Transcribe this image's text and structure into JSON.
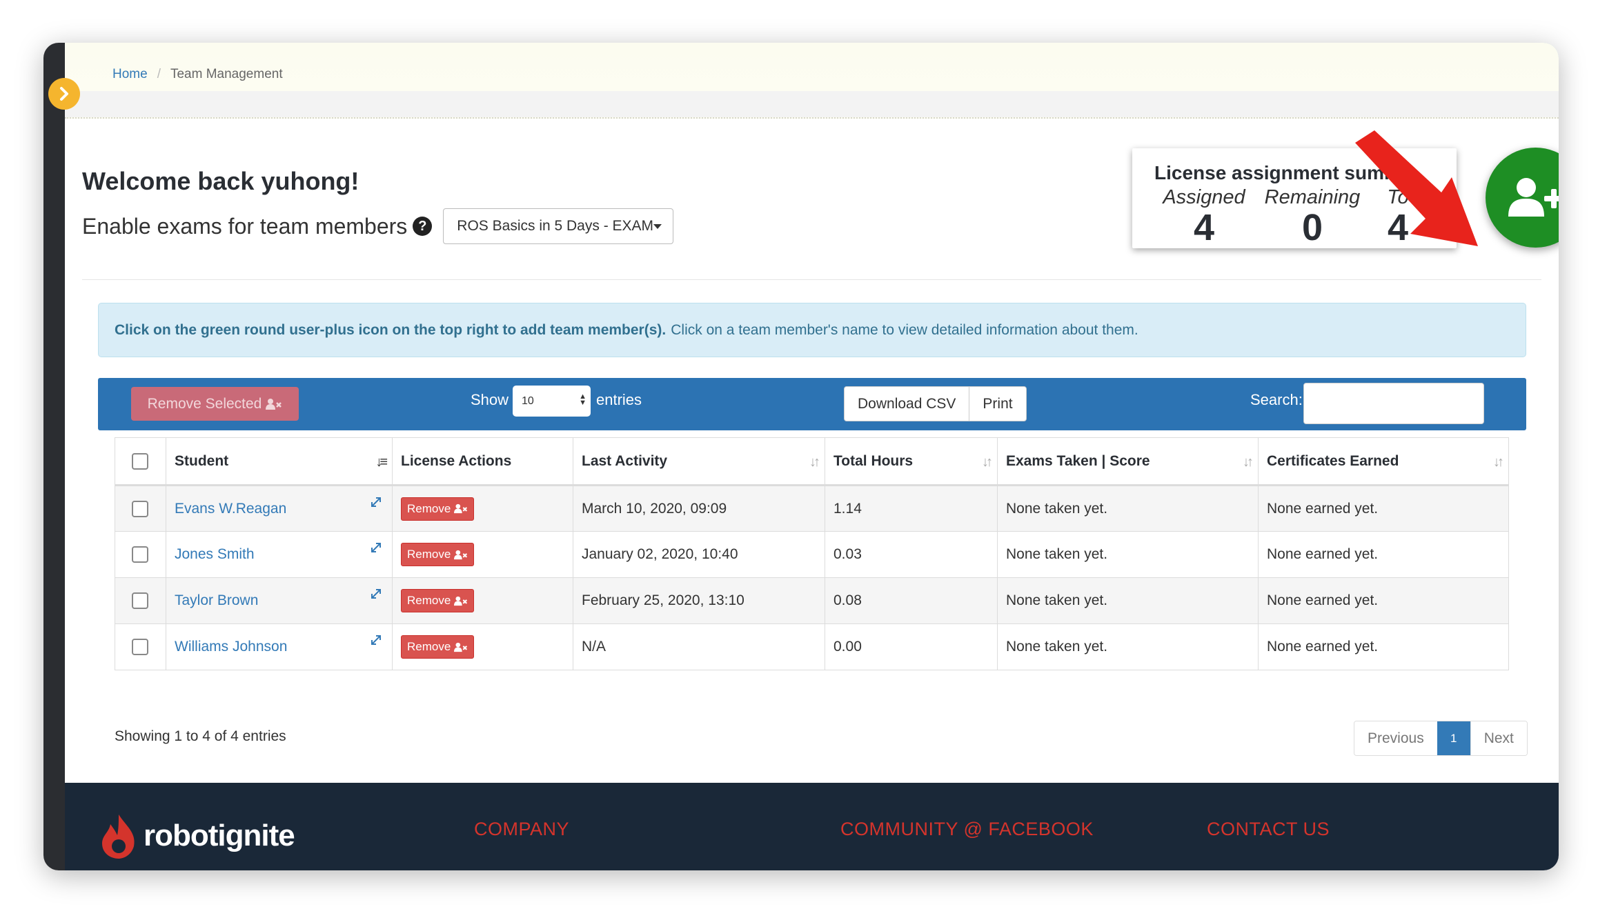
{
  "breadcrumb": {
    "home": "Home",
    "separator": "/",
    "current": "Team Management"
  },
  "welcome": "Welcome back yuhong!",
  "enable": {
    "label": "Enable exams for team members",
    "help_icon": "question-circle-icon",
    "exam_selected": "ROS Basics in 5 Days - EXAM"
  },
  "summary": {
    "title": "License assignment summa",
    "assigned_label": "Assigned",
    "assigned_value": "4",
    "remaining_label": "Remaining",
    "remaining_value": "0",
    "total_label": "To",
    "total_value": "4"
  },
  "info": {
    "bold": "Click on the green round user-plus icon on the top right to add team member(s).",
    "normal": "Click on a team member's name to view detailed information about them."
  },
  "toolbar": {
    "remove_selected": "Remove Selected",
    "show": "Show",
    "entries_value": "10",
    "entries": "entries",
    "download_csv": "Download CSV",
    "print": "Print",
    "search": "Search:"
  },
  "table": {
    "headers": [
      "Student",
      "License Actions",
      "Last Activity",
      "Total Hours",
      "Exams Taken | Score",
      "Certificates Earned"
    ],
    "remove_label": "Remove",
    "rows": [
      {
        "student": "Evans W.Reagan",
        "last_activity": "March 10, 2020, 09:09",
        "total_hours": "1.14",
        "exams": "None taken yet.",
        "certificates": "None earned yet."
      },
      {
        "student": "Jones Smith",
        "last_activity": "January 02, 2020, 10:40",
        "total_hours": "0.03",
        "exams": "None taken yet.",
        "certificates": "None earned yet."
      },
      {
        "student": "Taylor Brown",
        "last_activity": "February 25, 2020, 13:10",
        "total_hours": "0.08",
        "exams": "None taken yet.",
        "certificates": "None earned yet."
      },
      {
        "student": "Williams Johnson",
        "last_activity": "N/A",
        "total_hours": "0.00",
        "exams": "None taken yet.",
        "certificates": "None earned yet."
      }
    ]
  },
  "showing": "Showing 1 to 4 of 4 entries",
  "pagination": {
    "previous": "Previous",
    "current": "1",
    "next": "Next"
  },
  "footer": {
    "logo_text": "robotignite",
    "company": "COMPANY",
    "community": "COMMUNITY @ FACEBOOK",
    "contact": "CONTACT US"
  },
  "colors": {
    "accent_blue": "#2c73b3",
    "add_green": "#1e8e24",
    "danger_red": "#d9534f",
    "footer_bg": "#1a2838",
    "annotation_arrow": "#e8231c"
  }
}
